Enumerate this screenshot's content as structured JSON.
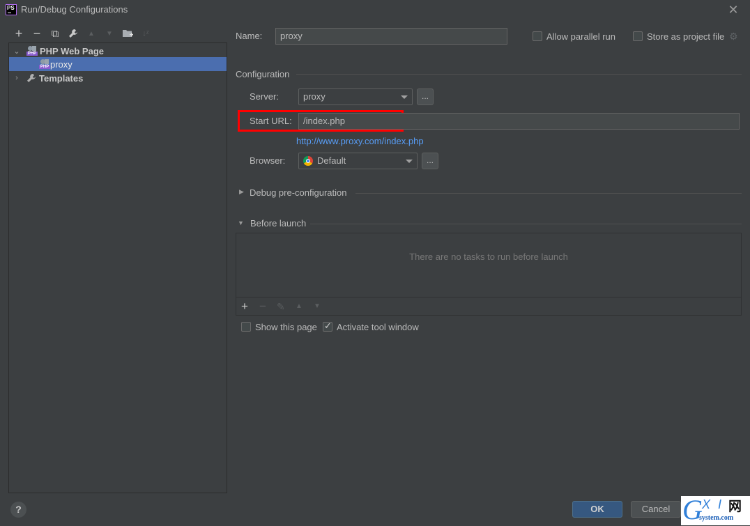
{
  "window": {
    "app_icon": "PS",
    "title": "Run/Debug Configurations",
    "close_icon": "close-icon"
  },
  "toolbar": {
    "items": [
      {
        "icon": "add-icon",
        "glyph": "+",
        "enabled": true
      },
      {
        "icon": "remove-icon",
        "glyph": "−",
        "enabled": true
      },
      {
        "icon": "copy-icon",
        "glyph": "⧉",
        "enabled": true
      },
      {
        "icon": "wrench-icon",
        "glyph": "🔧",
        "enabled": true
      },
      {
        "icon": "move-up-icon",
        "glyph": "▲",
        "enabled": false
      },
      {
        "icon": "move-down-icon",
        "glyph": "▼",
        "enabled": false
      },
      {
        "icon": "new-folder-icon",
        "glyph": "▆",
        "enabled": true
      },
      {
        "icon": "sort-icon",
        "glyph": "↓ᵃᶻ",
        "enabled": false
      }
    ]
  },
  "tree": {
    "group": {
      "label": "PHP Web Page",
      "icon": "php-web-page-icon",
      "expanded": true
    },
    "child": {
      "label": "proxy",
      "selected": true
    },
    "templates": {
      "label": "Templates",
      "icon": "wrench-icon",
      "expanded": false
    }
  },
  "form": {
    "name_label": "Name:",
    "name_value": "proxy",
    "allow_parallel_label": "Allow parallel run",
    "allow_parallel_checked": false,
    "store_project_label": "Store as project file",
    "store_project_checked": false,
    "configuration_header": "Configuration",
    "server_label": "Server:",
    "server_value": "proxy",
    "more_button": "...",
    "start_url_label": "Start URL:",
    "start_url_value": "/index.php",
    "resolved_url": "http://www.proxy.com/index.php",
    "browser_label": "Browser:",
    "browser_value": "Default",
    "debug_preconfig_header": "Debug pre-configuration",
    "before_launch_header": "Before launch",
    "before_launch_empty": "There are no tasks to run before launch",
    "show_page_label": "Show this page",
    "show_page_checked": false,
    "activate_tool_label": "Activate tool window",
    "activate_tool_checked": true
  },
  "footer": {
    "help": "?",
    "ok": "OK",
    "cancel": "Cancel"
  },
  "watermark": {
    "g": "G",
    "xi": "X I",
    "cn": "网",
    "domain": "system.com"
  }
}
